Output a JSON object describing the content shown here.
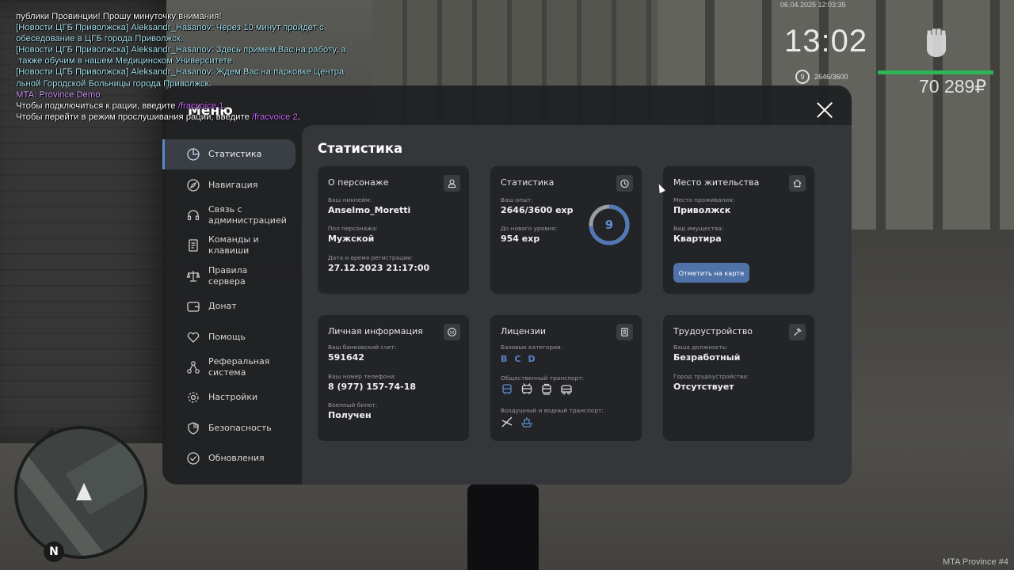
{
  "chat": {
    "lines": [
      {
        "text": "публики Провинции! Прошу минуточку внимания!",
        "color": "#ffffff"
      },
      {
        "text": "[Новости ЦГБ Приволжска] Aleksandr_Hasanov: Через 10 минут пройдет с",
        "color": "#a9e6f2"
      },
      {
        "text": "обеседование в ЦГБ города Приволжск.",
        "color": "#a9e6f2"
      },
      {
        "text": "[Новости ЦГБ Приволжска] Aleksandr_Hasanov: Здесь примем Вас на работу, а",
        "color": "#a9e6f2"
      },
      {
        "text": " также обучим в нашем Медицинском Университете.",
        "color": "#a9e6f2"
      },
      {
        "text": "[Новости ЦГБ Приволжска] Aleksandr_Hasanov: Ждем Вас на парковке Центра",
        "color": "#a9e6f2"
      },
      {
        "text": "льной Городской Больницы города Приволжск.",
        "color": "#a9e6f2"
      },
      {
        "text": "MTA: Province Demo",
        "color": "#d49bff"
      }
    ],
    "radio_line": {
      "prefix": "Чтобы подключиться к рации, введите ",
      "command": "/fracvoice 1",
      "suffix": "."
    },
    "listen_line": {
      "prefix": "Чтобы перейти в режим прослушивания рации, введите ",
      "command": "/fracvoice 2",
      "suffix": "."
    }
  },
  "hud": {
    "datetime": "06.04.2025 12:03:35",
    "clock": "13:02",
    "level": "9",
    "exp": "2646/3600",
    "money": "70 289₽",
    "health_fraction": 1.0,
    "health_color": "#2fb559",
    "watermark": "MTA Province #4"
  },
  "minimap": {
    "north_label": "N"
  },
  "menu": {
    "title": "Меню",
    "accent_color": "#5f88c7",
    "sidebar": [
      {
        "label": "Статистика",
        "icon": "pie-chart-icon",
        "active": true
      },
      {
        "label": "Навигация",
        "icon": "compass-icon"
      },
      {
        "label": "Связь с администрацией",
        "icon": "headset-icon"
      },
      {
        "label": "Команды и клавиши",
        "icon": "document-icon"
      },
      {
        "label": "Правила сервера",
        "icon": "scales-icon"
      },
      {
        "label": "Донат",
        "icon": "wallet-icon"
      },
      {
        "label": "Помощь",
        "icon": "heart-hand-icon"
      },
      {
        "label": "Реферальная система",
        "icon": "network-icon"
      },
      {
        "label": "Настройки",
        "icon": "gear-icon"
      },
      {
        "label": "Безопасность",
        "icon": "shield-icon"
      },
      {
        "label": "Обновления",
        "icon": "refresh-check-icon"
      }
    ],
    "content_title": "Статистика",
    "cards": {
      "character": {
        "title": "О персонаже",
        "nickname_label": "Ваш никнейм:",
        "nickname": "Anselmo_Moretti",
        "gender_label": "Пол персонажа:",
        "gender": "Мужской",
        "reg_label": "Дата и время регистрации:",
        "reg": "27.12.2023 21:17:00"
      },
      "stats": {
        "title": "Статистика",
        "exp_label": "Ваш опыт:",
        "exp": "2646/3600 exp",
        "next_label": "До нового уровня:",
        "next": "954 exp",
        "level": "9",
        "progress": 0.735
      },
      "residence": {
        "title": "Место жительства",
        "place_label": "Место проживания:",
        "place": "Приволжск",
        "property_label": "Вид имущества:",
        "property": "Квартира",
        "map_button": "Отметить на карте"
      },
      "personal": {
        "title": "Личная информация",
        "bank_label": "Ваш банковский счет:",
        "bank": "591642",
        "phone_label": "Ваш номер телефона:",
        "phone": "8 (977) 157-74-18",
        "military_label": "Военный билет:",
        "military": "Получен"
      },
      "licenses": {
        "title": "Лицензии",
        "base_label": "Базовые категории:",
        "categories": [
          "B",
          "C",
          "D"
        ],
        "public_label": "Общественный транспорт:",
        "public_icons": [
          "bus-icon",
          "trolleybus-icon",
          "tram-icon",
          "minibus-icon"
        ],
        "air_water_label": "Воздушный и водный транспорт:",
        "air_water_icons": [
          "plane-icon",
          "boat-icon"
        ]
      },
      "job": {
        "title": "Трудоустройство",
        "position_label": "Ваша должность:",
        "position": "Безработный",
        "city_label": "Город трудоустройства:",
        "city": "Отсутствует"
      }
    }
  }
}
